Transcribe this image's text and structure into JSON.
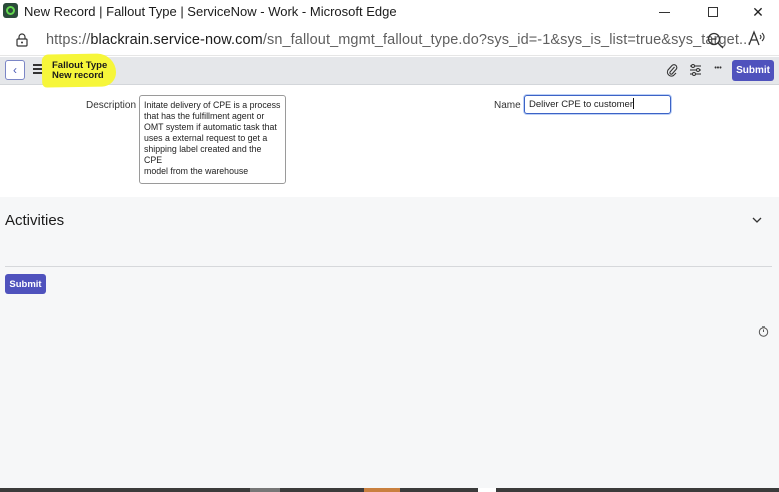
{
  "window": {
    "title": "New Record | Fallout Type | ServiceNow - Work - Microsoft Edge",
    "minimize_icon": "minimize-icon",
    "maximize_icon": "maximize-icon",
    "close_glyph": "✕"
  },
  "addressbar": {
    "url_prefix": "https://",
    "url_host": "blackrain.service-now.com",
    "url_path": "/sn_fallout_mgmt_fallout_type.do?sys_id=-1&sys_is_list=true&sys_target..."
  },
  "header": {
    "back_glyph": "‹",
    "record_type": "Fallout Type",
    "record_name": "New record",
    "more_glyph": "•••",
    "submit_label": "Submit",
    "highlight_color": "#f6f63a"
  },
  "form": {
    "description_label": "Description",
    "description_value": "Initate delivery of CPE is a process\nthat has the fulfillment agent or\nOMT system if automatic task that\nuses a external request to get a\nshipping label created and the CPE\nmodel from the warehouse",
    "name_label": "Name",
    "name_value": "Deliver CPE to customer"
  },
  "activities": {
    "title": "Activities"
  },
  "footer": {
    "submit_label": "Submit"
  },
  "colors": {
    "accent": "#4f52bd",
    "header_bg": "#e5e7ea",
    "section_bg": "#f6f7f8"
  }
}
